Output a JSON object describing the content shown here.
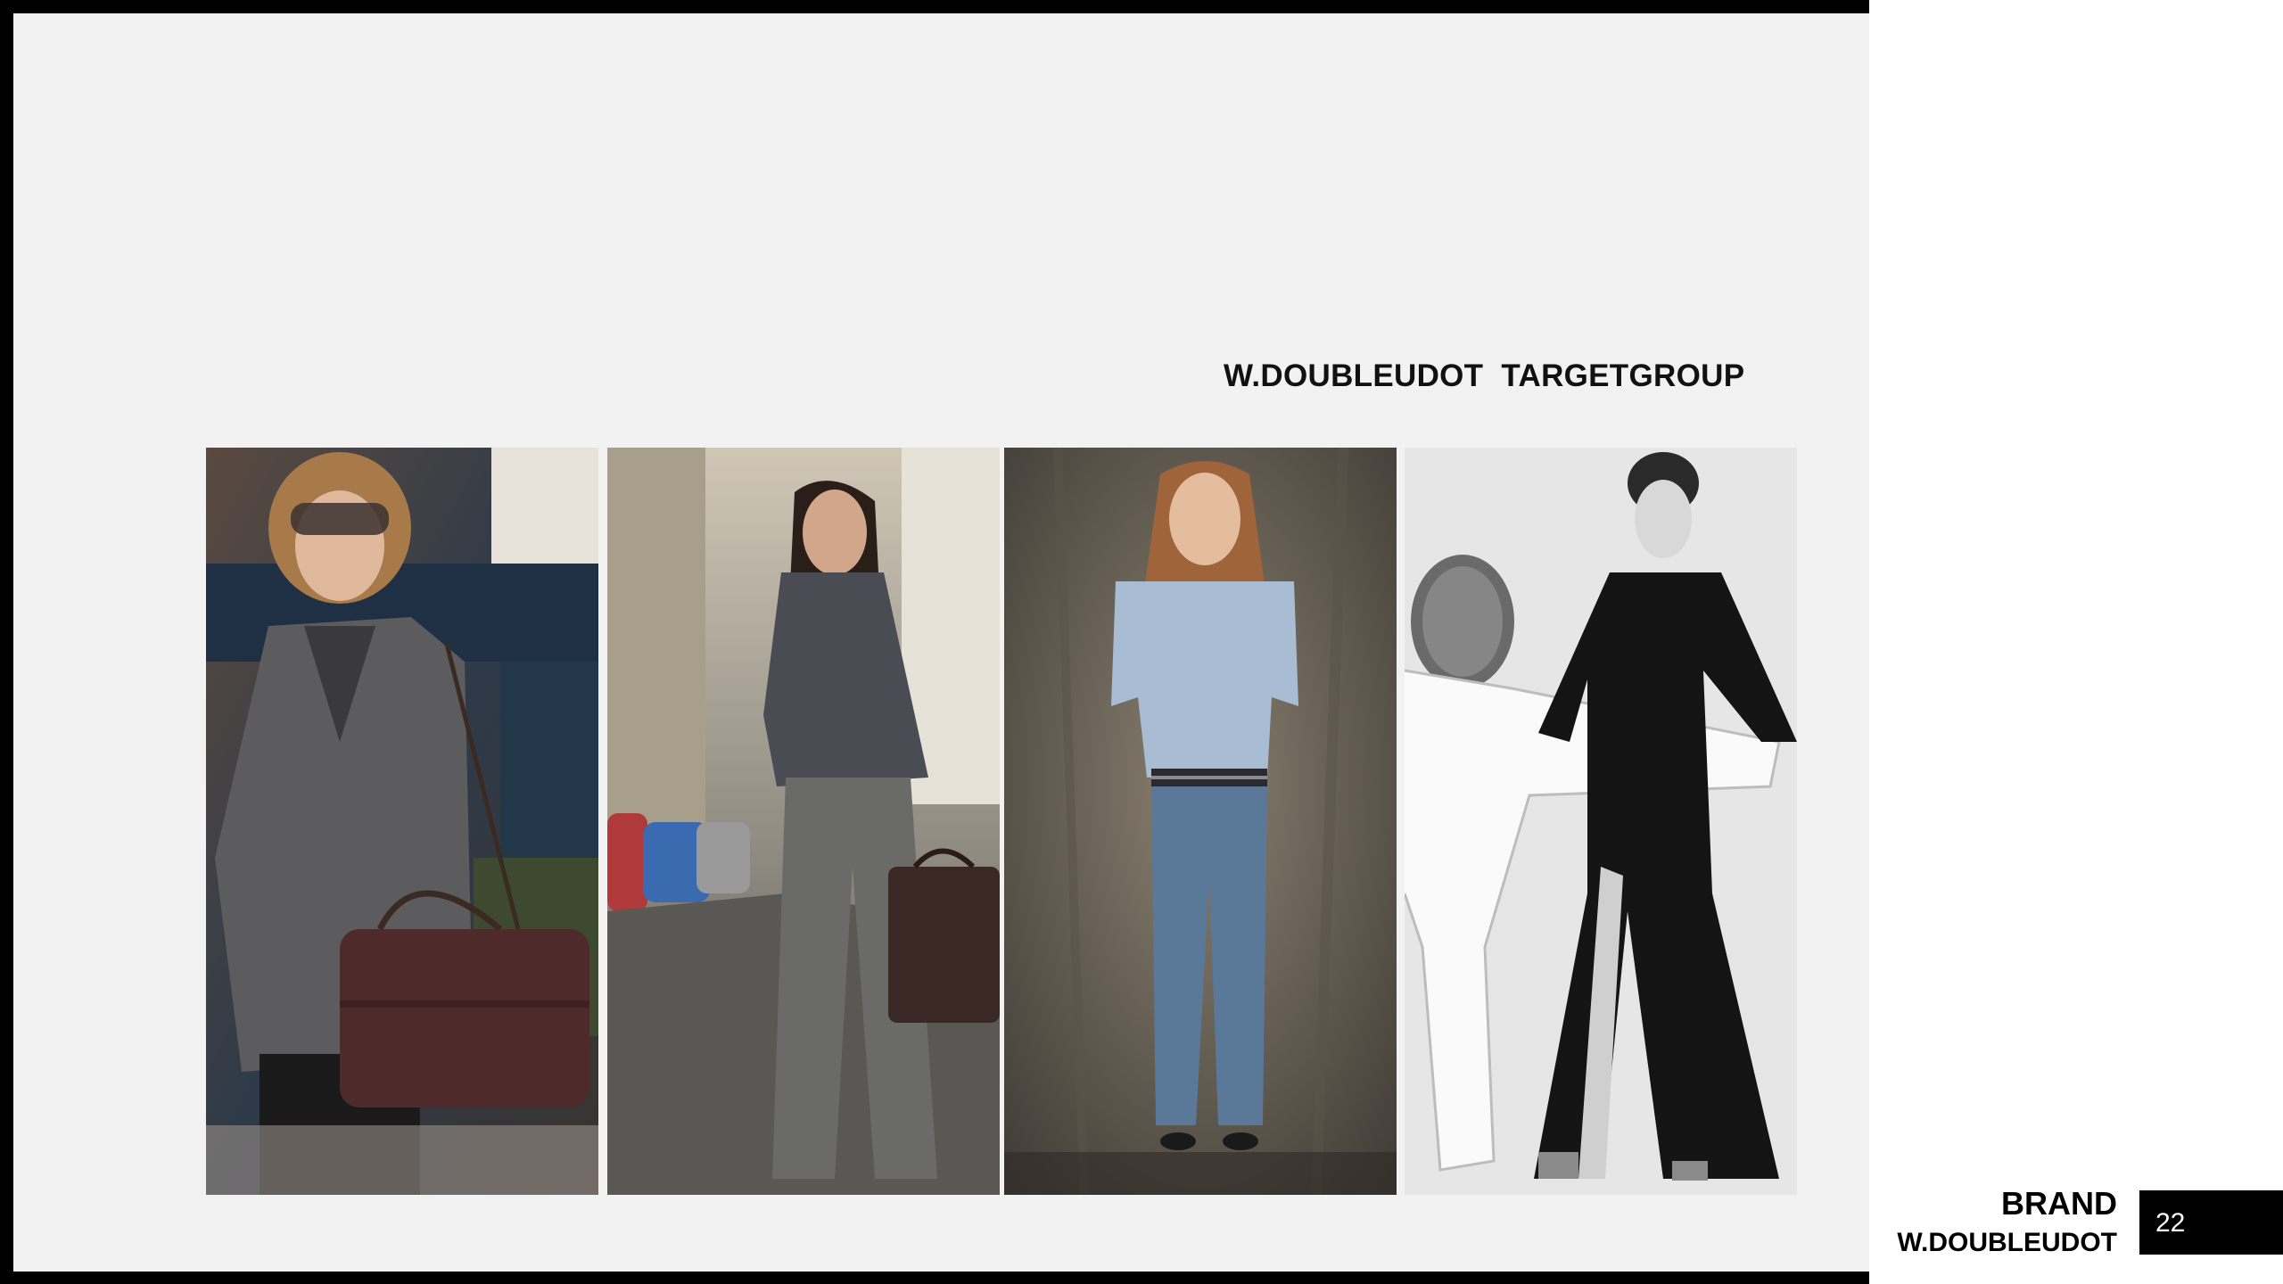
{
  "slide": {
    "title": "W.DOUBLEUDOT  TARGETGROUP",
    "brand_line1": "BRAND",
    "brand_line2": "W.DOUBLEUDOT",
    "page_number": "22"
  },
  "photos": [
    {
      "subject": "woman-grey-coat-burgundy-handbag"
    },
    {
      "subject": "woman-grey-shirt-trousers-street"
    },
    {
      "subject": "woman-blue-sweater-jeans"
    },
    {
      "subject": "woman-black-gown-fencer"
    }
  ],
  "colors": {
    "frame": "#000000",
    "slide_bg": "#f2f2f2",
    "text": "#111111",
    "page_box": "#000000"
  }
}
